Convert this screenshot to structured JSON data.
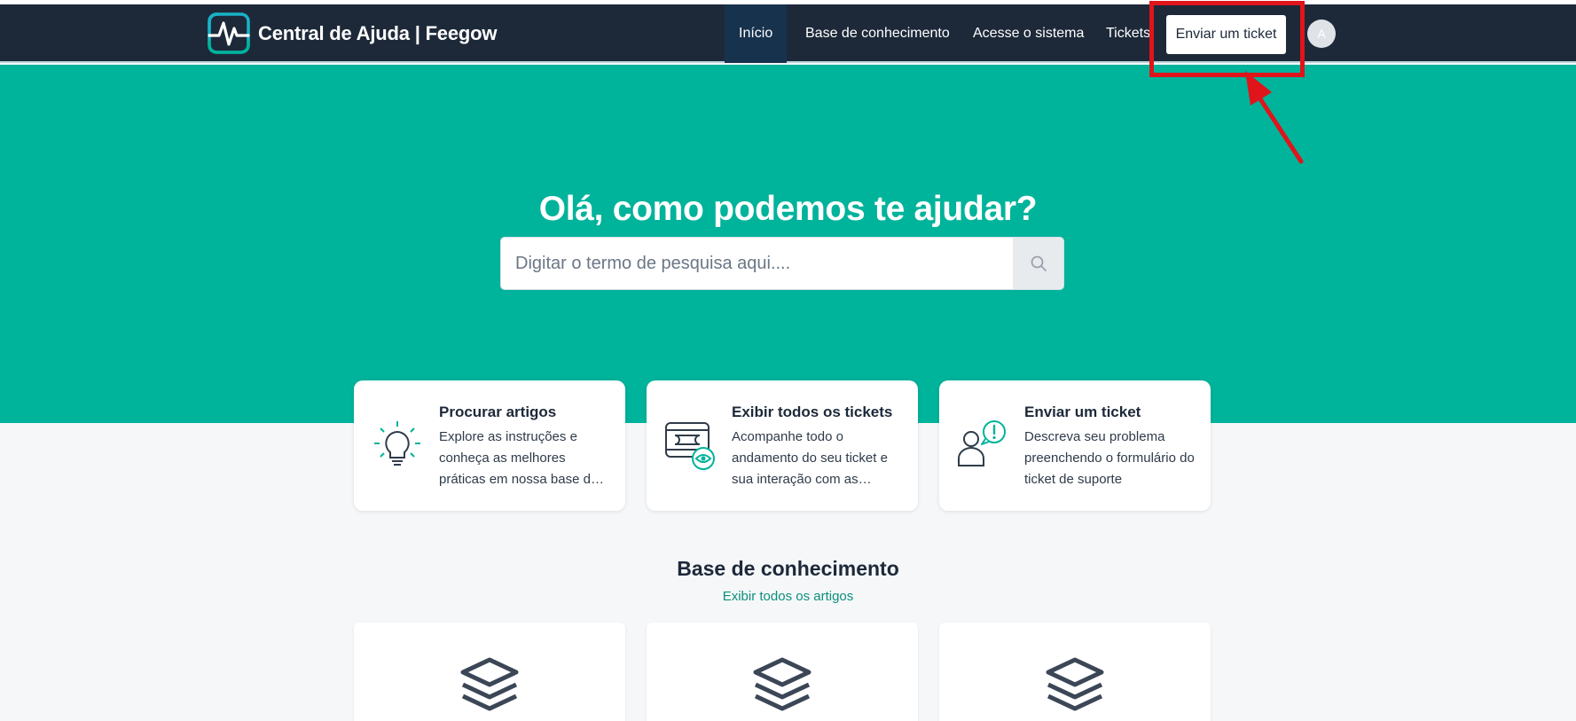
{
  "brand": {
    "title": "Central de Ajuda | Feegow",
    "logo_icon": "pulse-logo-icon"
  },
  "nav": {
    "items": [
      "Início",
      "Base de conhecimento",
      "Acesse o sistema",
      "Tickets"
    ],
    "cta_label": "Enviar um ticket",
    "avatar_initial": "A"
  },
  "hero": {
    "title": "Olá, como podemos te ajudar?",
    "search_placeholder": "Digitar o termo de pesquisa aqui....",
    "search_icon": "search-icon"
  },
  "cards": [
    {
      "icon": "lightbulb-icon",
      "title": "Procurar artigos",
      "description": "Explore as instruções e conheça as melhores práticas em nossa base de conhecimento"
    },
    {
      "icon": "tickets-eye-icon",
      "title": "Exibir todos os tickets",
      "description": "Acompanhe todo o andamento do seu ticket e sua interação com as equipes"
    },
    {
      "icon": "user-alert-icon",
      "title": "Enviar um ticket",
      "description": "Descreva seu problema preenchendo o formulário do ticket de suporte"
    }
  ],
  "knowledge_base": {
    "title": "Base de conhecimento",
    "link_label": "Exibir todos os artigos",
    "card_icon": "layers-icon"
  },
  "colors": {
    "header_bg": "#1d2939",
    "hero_bg": "#00b39b",
    "accent_text": "#0d8f7c",
    "annotation": "#e0141b"
  }
}
